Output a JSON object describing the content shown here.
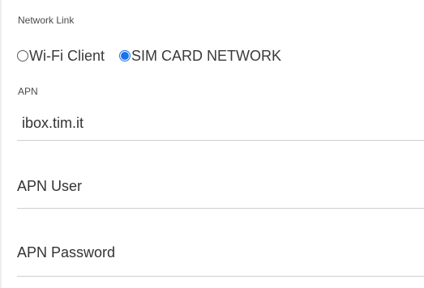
{
  "network_link": {
    "label": "Network Link",
    "options": [
      {
        "label": "Wi-Fi Client",
        "selected": false
      },
      {
        "label": "SIM CARD NETWORK",
        "selected": true
      }
    ]
  },
  "apn": {
    "label": "APN",
    "value": "ibox.tim.it"
  },
  "apn_user": {
    "placeholder": "APN User",
    "value": ""
  },
  "apn_password": {
    "placeholder": "APN Password",
    "value": ""
  },
  "colors": {
    "accent": "#1a73e8",
    "divider": "#cfcfcf"
  }
}
